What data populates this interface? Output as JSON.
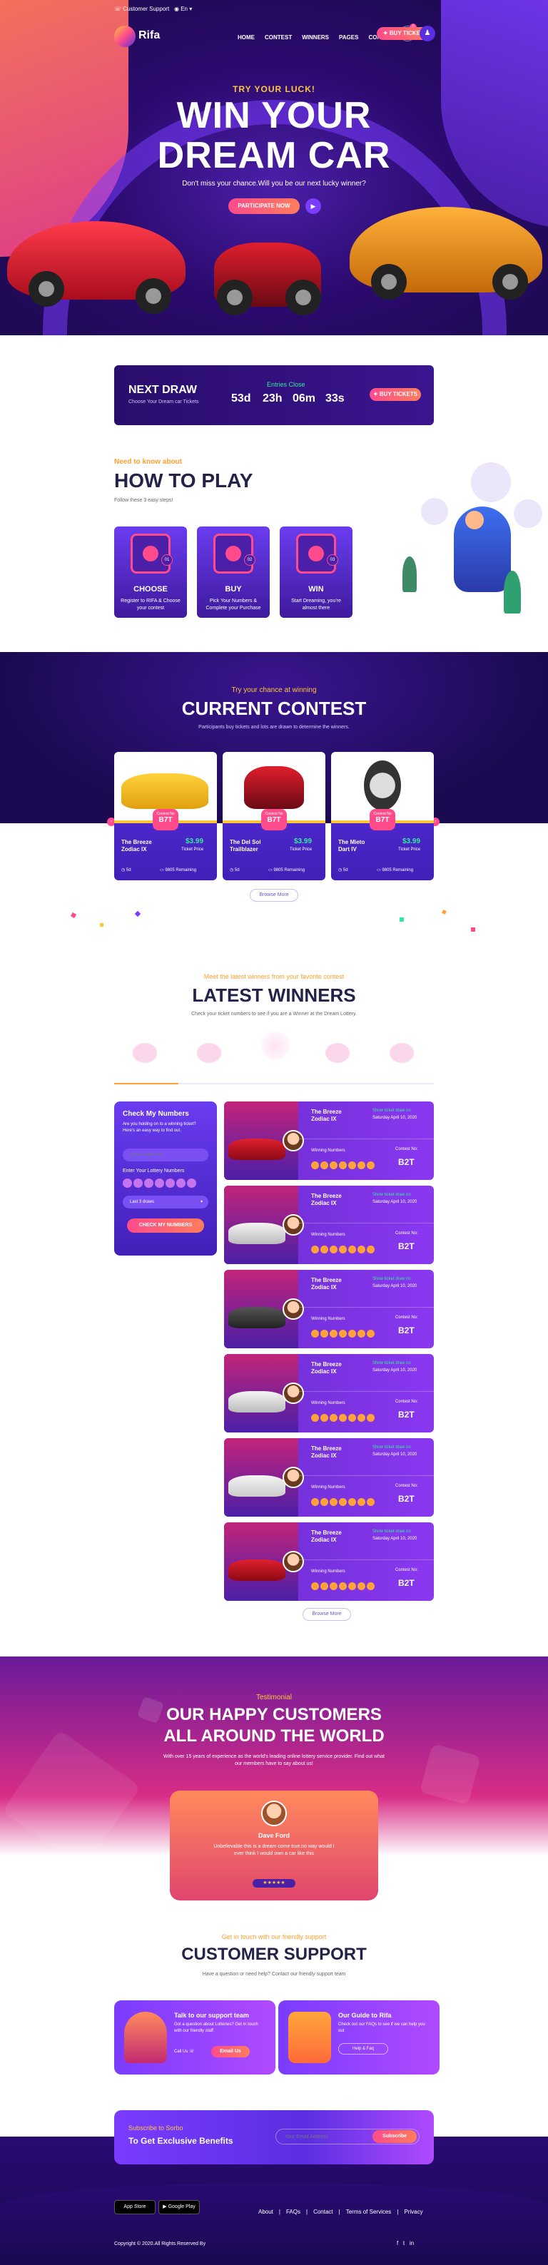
{
  "colors": {
    "accent": "#ff4b8b",
    "orange": "#ff9f2e",
    "purple": "#4b1fa8",
    "dark": "#23234a",
    "green": "#35e8a0"
  },
  "topbar": {
    "support": "Customer Support",
    "lang": "En"
  },
  "brand": {
    "name": "Rifa"
  },
  "nav": {
    "items": [
      "HOME",
      "CONTEST",
      "WINNERS",
      "PAGES",
      "CONTACT"
    ],
    "cta": "BUY TICKETS",
    "cart_count": "0"
  },
  "hero": {
    "kicker": "TRY YOUR LUCK!",
    "title_line1": "WIN YOUR",
    "title_line2": "DREAM CAR",
    "desc": "Don't miss your chance.Will you be our next lucky winner?",
    "cta": "PARTICIPATE NOW"
  },
  "next_draw": {
    "title": "NEXT DRAW",
    "subtitle": "Choose Your Dream car Tickets",
    "entries": "Entries Close",
    "days": "53d",
    "hours": "23h",
    "minutes": "06m",
    "seconds": "33s",
    "cta": "BUY TICKETS"
  },
  "how_to_play": {
    "kicker": "Need to know about",
    "title": "HOW TO PLAY",
    "desc": "Follow these 3 easy steps!",
    "cards": [
      {
        "num": "01",
        "title": "CHOOSE",
        "desc": "Register to RIFA & Choose your contest"
      },
      {
        "num": "02",
        "title": "BUY",
        "desc": "Pick Your Numbers & Complete your Purchase"
      },
      {
        "num": "03",
        "title": "WIN",
        "desc": "Start Dreaming, you're almost there"
      }
    ]
  },
  "contest": {
    "kicker": "Try your chance at winning",
    "title": "CURRENT CONTEST",
    "desc": "Participants buy tickets and lots are drawn to determine the winners.",
    "cards": [
      {
        "badge_top": "Contest No",
        "badge": "B7T",
        "name_line1": "The Breeze",
        "name_line2": "Zodiac IX",
        "price": "$3.99",
        "price_label": "Ticket Price",
        "days": "5d",
        "remaining": "9805 Remaining"
      },
      {
        "badge_top": "Contest No",
        "badge": "B7T",
        "name_line1": "The Del Sol",
        "name_line2": "Trailblazer",
        "price": "$3.99",
        "price_label": "Ticket Price",
        "days": "5d",
        "remaining": "9805 Remaining"
      },
      {
        "badge_top": "Contest No",
        "badge": "B7T",
        "name_line1": "The Mieto",
        "name_line2": "Dart IV",
        "price": "$3.99",
        "price_label": "Ticket Price",
        "days": "5d",
        "remaining": "9805 Remaining"
      }
    ],
    "browse": "Browse More"
  },
  "winners": {
    "kicker": "Meet the latest winners from your favorite contest",
    "title": "LATEST WINNERS",
    "desc": "Check your ticket numbers to see if you are a Winner at the Dream Lottery.",
    "check": {
      "title": "Check My Numbers",
      "desc": "Are you holding on to a winning ticket? Here's an easy way to find out.",
      "contest_placeholder": "Enter Contest No",
      "numbers_label": "Enter Your Lottery Numbers",
      "draw_placeholder": "Last 3 draws",
      "cta": "CHECK MY NUMBERS"
    },
    "rows": [
      {
        "name_line1": "The Breeze",
        "name_line2": "Zodiac IX",
        "date": "Saturday April 10, 2020",
        "show": "Show ticket draw no",
        "numbers_label": "Winning Numbers",
        "contest_label": "Contest No:",
        "contest": "B2T"
      },
      {
        "name_line1": "The Breeze",
        "name_line2": "Zodiac IX",
        "date": "Saturday April 10, 2020",
        "show": "Show ticket draw no",
        "numbers_label": "Winning Numbers",
        "contest_label": "Contest No:",
        "contest": "B2T"
      },
      {
        "name_line1": "The Breeze",
        "name_line2": "Zodiac IX",
        "date": "Saturday April 10, 2020",
        "show": "Show ticket draw no",
        "numbers_label": "Winning Numbers",
        "contest_label": "Contest No:",
        "contest": "B2T"
      },
      {
        "name_line1": "The Breeze",
        "name_line2": "Zodiac IX",
        "date": "Saturday April 10, 2020",
        "show": "Show ticket draw no",
        "numbers_label": "Winning Numbers",
        "contest_label": "Contest No:",
        "contest": "B2T"
      },
      {
        "name_line1": "The Breeze",
        "name_line2": "Zodiac IX",
        "date": "Saturday April 10, 2020",
        "show": "Show ticket draw no",
        "numbers_label": "Winning Numbers",
        "contest_label": "Contest No:",
        "contest": "B2T"
      },
      {
        "name_line1": "The Breeze",
        "name_line2": "Zodiac IX",
        "date": "Saturday April 10, 2020",
        "show": "Show ticket draw no",
        "numbers_label": "Winning Numbers",
        "contest_label": "Contest No:",
        "contest": "B2T"
      }
    ],
    "browse": "Browse More"
  },
  "testimonial": {
    "kicker": "Testimonial",
    "title_line1": "OUR HAPPY CUSTOMERS",
    "title_line2": "ALL AROUND THE WORLD",
    "desc": "With over 15 years of experience as the world's leading online lottery service provider. Find out what our members have to say about us!",
    "name": "Dave Ford",
    "quote": "Unbelievable this is a dream come true.no way would I ever think I would own a car like this"
  },
  "support": {
    "kicker": "Get in touch with our friendly support",
    "title": "CUSTOMER SUPPORT",
    "desc": "Have a question or need help? Contact our friendly support team",
    "cards": [
      {
        "title": "Talk to our support team",
        "desc": "Got a question about Lotteries? Get in touch with our friendly staff",
        "link": "Call Us",
        "cta": "Email Us"
      },
      {
        "title": "Our Guide to Rifa",
        "desc": "Check out our FAQs to see if we can help you out",
        "link": "Help & Faq"
      }
    ]
  },
  "subscribe": {
    "kicker": "Subscribe to Sorbo",
    "title": "To Get Exclusive Benefits",
    "placeholder": "Your Email Address",
    "cta": "Subscribe"
  },
  "footer": {
    "appstore": "App Store",
    "googleplay": "Google Play",
    "links": [
      "About",
      "FAQs",
      "Contact",
      "Terms of Services",
      "Privacy"
    ],
    "copyright": "Copyright © 2020.All Rights Reserved By"
  }
}
